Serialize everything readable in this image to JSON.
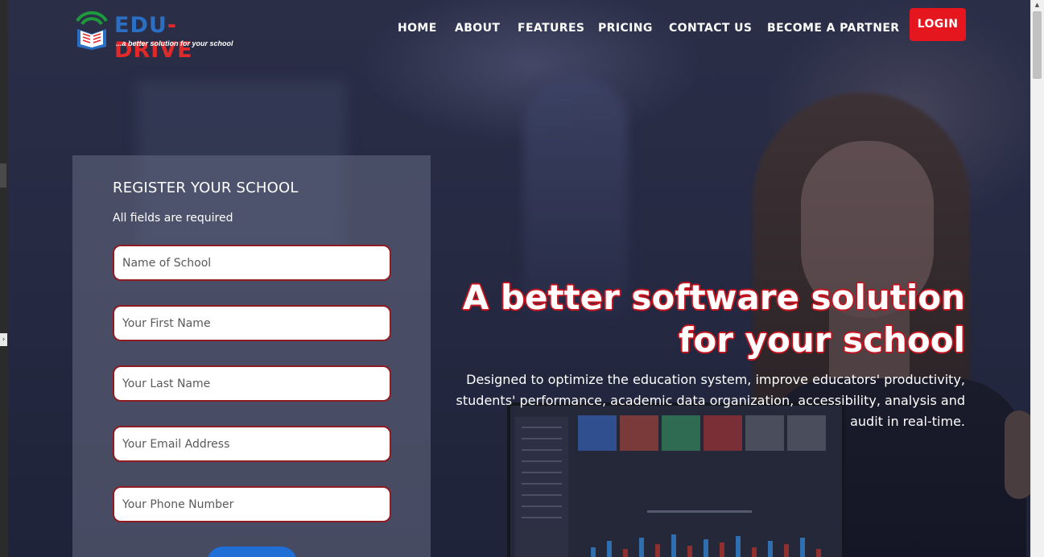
{
  "header": {
    "logo": {
      "name_part1": "EDU",
      "name_part2": "-DRIVE",
      "tagline": "...a better solution for your school"
    },
    "nav": [
      {
        "label": "HOME"
      },
      {
        "label": "ABOUT"
      },
      {
        "label": "FEATURES"
      },
      {
        "label": "PRICING"
      },
      {
        "label": "CONTACT US"
      },
      {
        "label": "BECOME A PARTNER"
      }
    ],
    "login_label": "LOGIN"
  },
  "register": {
    "title": "REGISTER YOUR SCHOOL",
    "subtitle": "All fields are required",
    "fields": [
      {
        "placeholder": "Name of School",
        "value": ""
      },
      {
        "placeholder": "Your First Name",
        "value": ""
      },
      {
        "placeholder": "Your Last Name",
        "value": ""
      },
      {
        "placeholder": "Your Email Address",
        "value": ""
      },
      {
        "placeholder": "Your Phone Number",
        "value": ""
      }
    ]
  },
  "hero": {
    "headline_line1": "A better software solution",
    "headline_line2": "for your school",
    "description": "Designed to optimize the education system, improve educators' productivity, students' performance, academic data organization, accessibility, analysis and audit in real-time."
  },
  "colors": {
    "accent_red": "#e6161e",
    "logo_blue": "#2b6fc4",
    "field_border": "#8f1c22",
    "submit_blue": "#1f6fd6"
  },
  "icons": [
    "logo-book-wifi-icon",
    "chevron-right-icon",
    "scroll-up-arrow-icon"
  ]
}
